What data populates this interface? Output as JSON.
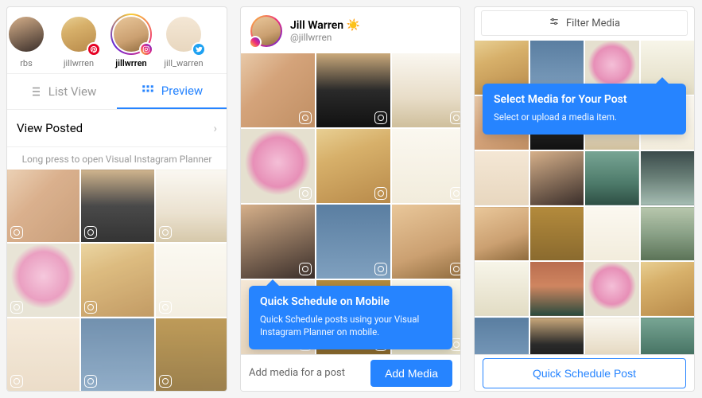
{
  "panel1": {
    "stories": [
      {
        "label": "rbs",
        "platform": "none"
      },
      {
        "label": "jillwrren",
        "platform": "pinterest"
      },
      {
        "label": "jillwrren",
        "platform": "instagram",
        "active": true
      },
      {
        "label": "jill_warren",
        "platform": "twitter"
      }
    ],
    "tabs": {
      "list_view": "List View",
      "preview": "Preview"
    },
    "view_posted": "View Posted",
    "hint": "Long press to open Visual Instagram Planner"
  },
  "panel2": {
    "profile": {
      "name": "Jill Warren ☀️",
      "handle": "@jillwrren"
    },
    "tooltip": {
      "title": "Quick Schedule on Mobile",
      "body": "Quick Schedule posts using your Visual Instagram Planner on mobile."
    },
    "footer_text": "Add media for a post",
    "add_media": "Add Media"
  },
  "panel3": {
    "filter_label": "Filter Media",
    "tooltip": {
      "title": "Select Media for Your Post",
      "body": "Select or upload a media item."
    },
    "quick_schedule": "Quick Schedule Post"
  },
  "thumbs": {
    "hand_ring": "linear-gradient(135deg,#e8c9a8 0%,#d4a37a 40%,#c08f64 100%)",
    "portrait_black": "linear-gradient(180deg,#caa97b 0%,#2a2a2a 50%,#111 100%)",
    "rabbit": "linear-gradient(180deg,#faf7f0 0%,#e8ddc8 60%,#cfbf9c 100%)",
    "peony": "radial-gradient(circle at 50% 45%,#f4bfd7 0%,#e78fb7 45%,#e5e0cf 60%,#e5e0cf 100%)",
    "selfie_sun": "linear-gradient(160deg,#e8cf93 0%,#d7b06a 35%,#b88a4a 100%)",
    "text_card": "linear-gradient(180deg,#fbf8f0 0%,#f2ecdc 100%)",
    "flower_blue": "linear-gradient(180deg,#5a7ea1 0%,#7fa0bf 100%)",
    "gold_thing": "linear-gradient(180deg,#b38a3c 0%,#8a6a2e 100%)",
    "close_selfie": "linear-gradient(160deg,#e9c79a 0%,#cba071 60%,#8f6b3d 100%)",
    "balcony": "linear-gradient(180deg,#78a594 0%,#4d7a6a 60%,#2e4f44 100%)",
    "arches": "linear-gradient(180deg,#3a4a4a 0%,#6a8078 50%,#a6bdb3 100%)",
    "pastel": "linear-gradient(180deg,#f4e7d5 0%,#e8d7bf 100%)",
    "street": "linear-gradient(180deg,#b8c7ad 0%,#8aa187 50%,#5b7357 100%)",
    "cafe": "linear-gradient(180deg,#b96d4f 0%,#cf8560 45%,#284a3d 100%)",
    "portrait2": "linear-gradient(160deg,#d6b08a 0%,#3a2e2a 100%)",
    "white_flower": "linear-gradient(180deg,#f7f5e9 0%,#e2dcc4 100%)"
  }
}
